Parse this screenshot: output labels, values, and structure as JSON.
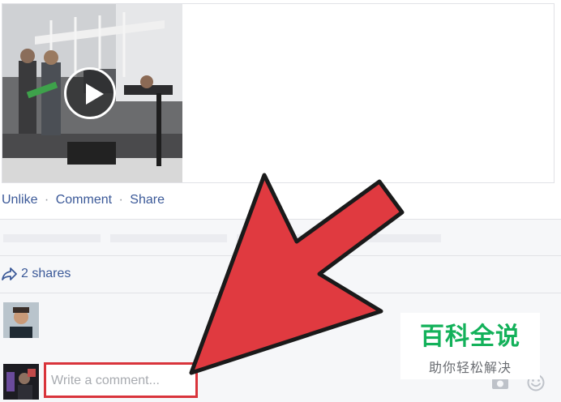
{
  "post": {
    "actions": {
      "unlike": "Unlike",
      "separator": "·",
      "comment": "Comment",
      "share": "Share"
    },
    "shares_text": "2 shares"
  },
  "comment": {
    "placeholder": "Write a comment..."
  },
  "icons": {
    "play": "play-icon",
    "share": "share-arrow-icon",
    "camera": "camera-icon",
    "emoji": "emoji-icon"
  },
  "watermark": {
    "title": "百科全说",
    "subtitle": "助你轻松解决"
  },
  "colors": {
    "link": "#3b5998",
    "highlight_box": "#d9343b",
    "arrow": "#e03a40",
    "watermark_green": "#13b15a",
    "comments_bg": "#f6f7f9"
  }
}
